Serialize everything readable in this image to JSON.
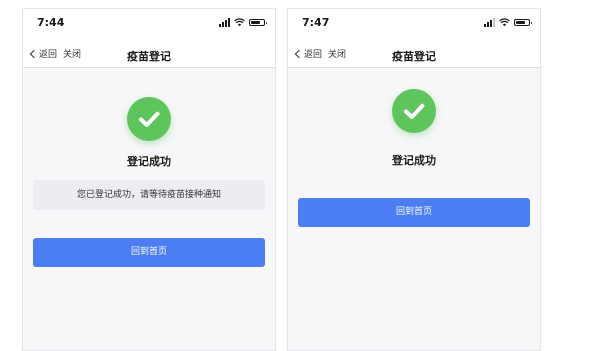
{
  "screens": [
    {
      "status_bar": {
        "time": "7:44",
        "signal_bars_filled": 4
      },
      "nav": {
        "back_label": "返回",
        "close_label": "关闭",
        "title": "疫苗登记"
      },
      "content": {
        "success_title": "登记成功",
        "notice": "您已登记成功，请等待疫苗接种通知",
        "home_button": "回到首页"
      }
    },
    {
      "status_bar": {
        "time": "7:47",
        "signal_bars_filled": 3
      },
      "nav": {
        "back_label": "返回",
        "close_label": "关闭",
        "title": "疫苗登记"
      },
      "content": {
        "success_title": "登记成功",
        "home_button": "回到首页"
      }
    }
  ],
  "colors": {
    "accent_button": "#4b7ef2",
    "success_green": "#5ec45c",
    "notice_background": "#ededf1"
  },
  "icons": [
    "back-chevron-icon",
    "signal-icon",
    "wifi-icon",
    "battery-icon",
    "checkmark-icon"
  ]
}
